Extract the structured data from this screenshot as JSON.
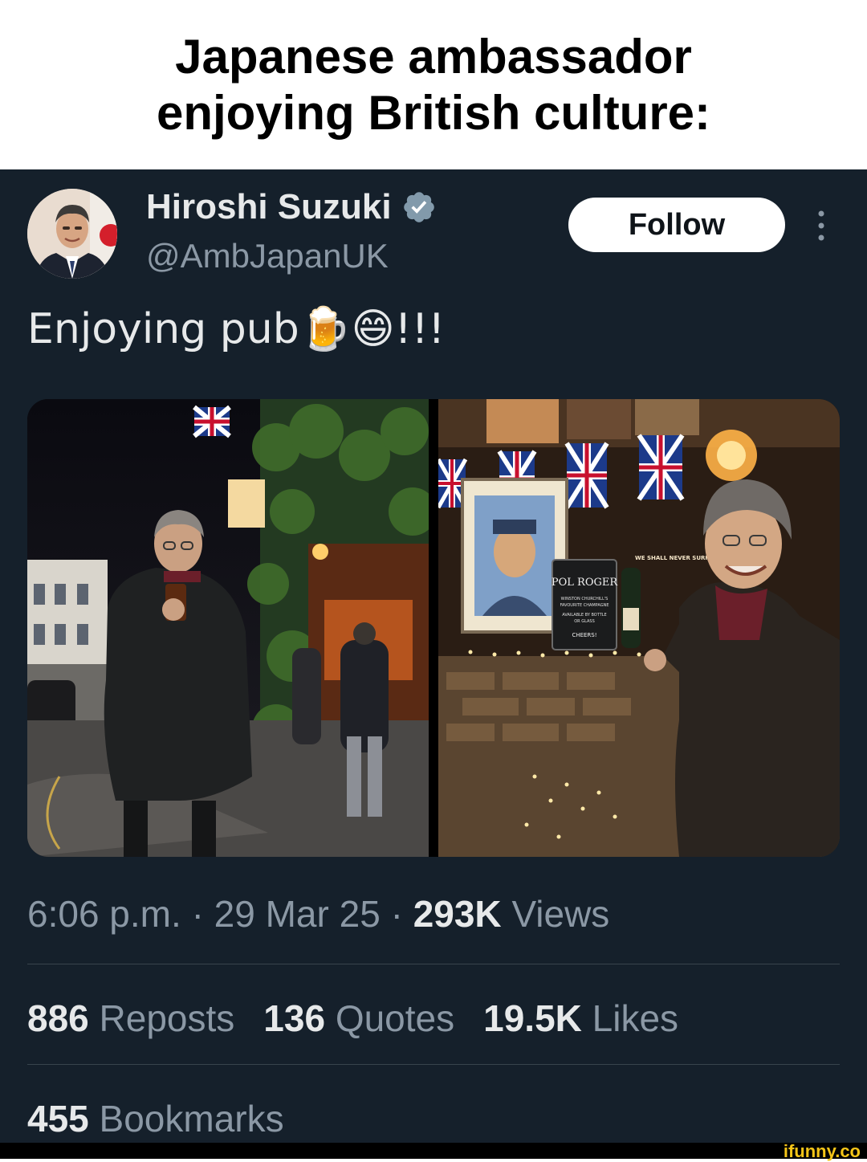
{
  "caption": {
    "line1": "Japanese ambassador",
    "line2": "enjoying British culture:"
  },
  "tweet": {
    "display_name": "Hiroshi Suzuki",
    "handle": "@AmbJapanUK",
    "follow_label": "Follow",
    "text": "Enjoying pub🍺😄!!!",
    "time": "6:06 p.m.",
    "date": "29 Mar 25",
    "views_count": "293K",
    "views_label": "Views",
    "reposts_count": "886",
    "reposts_label": "Reposts",
    "quotes_count": "136",
    "quotes_label": "Quotes",
    "likes_count": "19.5K",
    "likes_label": "Likes",
    "bookmarks_count": "455",
    "bookmarks_label": "Bookmarks"
  },
  "sign": {
    "brand": "POL ROGER",
    "lines": [
      "WINSTON CHURCHILL'S",
      "FAVOURITE CHAMPAGNE",
      "AVAILABLE BY BOTTLE",
      "OR GLASS",
      "CHEERS!"
    ],
    "banner": "WE SHALL NEVER SURRENDER"
  },
  "watermark": "ifunny.co",
  "icons": {
    "verified": "verified-badge-icon",
    "more": "more-vertical-icon"
  },
  "colors": {
    "background": "#15202b",
    "text_primary": "#e7e9ea",
    "text_secondary": "#8b98a5",
    "verified": "#829aab",
    "divider": "#38444d"
  }
}
